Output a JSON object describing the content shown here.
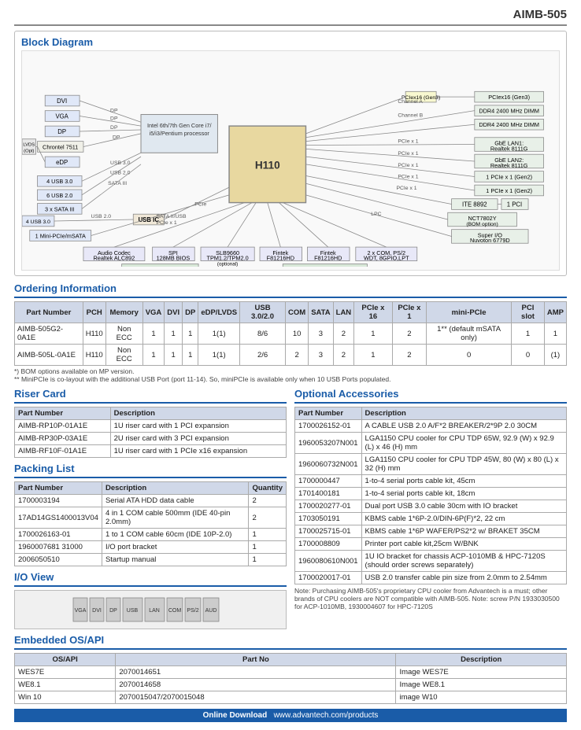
{
  "header": {
    "model": "AIMB-505"
  },
  "block_diagram": {
    "title": "Block Diagram"
  },
  "ordering": {
    "title": "Ordering Information",
    "columns": [
      "Part Number",
      "PCH",
      "Memory",
      "VGA",
      "DVI",
      "DP",
      "eDP/LVDS",
      "USB 3.0/2.0",
      "COM",
      "SATA",
      "LAN",
      "PCIe x 16",
      "PCIe x 1",
      "mini-PCIe",
      "PCI slot",
      "AMP"
    ],
    "rows": [
      [
        "AIMB-505G2-0A1E",
        "H110",
        "Non ECC",
        "1",
        "1",
        "1",
        "1(1)",
        "8/6",
        "10",
        "3",
        "2",
        "1",
        "2",
        "1** (default mSATA only)",
        "1",
        "1"
      ],
      [
        "AIMB-505L-0A1E",
        "H110",
        "Non ECC",
        "1",
        "1",
        "1",
        "1(1)",
        "2/6",
        "2",
        "3",
        "2",
        "1",
        "2",
        "0",
        "0",
        "(1)"
      ]
    ],
    "footnotes": [
      "*) BOM options available on MP version.",
      "** MiniPCIe is co-layout with the additional USB Port (port 11-14). So, miniPCIe is available only when 10 USB Ports populated."
    ]
  },
  "riser_card": {
    "title": "Riser Card",
    "columns": [
      "Part Number",
      "Description"
    ],
    "rows": [
      [
        "AIMB-RP10P-01A1E",
        "1U riser card with 1 PCI expansion"
      ],
      [
        "AIMB-RP30P-03A1E",
        "2U riser card with 3 PCI expansion"
      ],
      [
        "AIMB-RF10F-01A1E",
        "1U riser card with 1 PCIe x16 expansion"
      ]
    ]
  },
  "packing_list": {
    "title": "Packing List",
    "columns": [
      "Part Number",
      "Description",
      "Quantity"
    ],
    "rows": [
      [
        "1700003194",
        "Serial ATA HDD data cable",
        "2"
      ],
      [
        "17AD14GS1400013V04",
        "4 in 1 COM cable 500mm (IDE 40-pin 2.0mm)",
        "2"
      ],
      [
        "1700026163-01",
        "1 to 1 COM cable 60cm (IDE 10P-2.0)",
        "1"
      ],
      [
        "1960007681 31000",
        "I/O port bracket",
        "1"
      ],
      [
        "2006050510",
        "Startup manual",
        "1"
      ]
    ]
  },
  "optional_accessories": {
    "title": "Optional Accessories",
    "columns": [
      "Part Number",
      "Description"
    ],
    "rows": [
      [
        "1700026152-01",
        "A CABLE USB 2.0 A/F*2 BREAKER/2*9P 2.0 30CM"
      ],
      [
        "1960053207N001",
        "LGA1150 CPU cooler for CPU TDP 65W, 92.9 (W) x 92.9 (L) x 46 (H) mm"
      ],
      [
        "1960060732N001",
        "LGA1150 CPU cooler for CPU TDP 45W, 80 (W) x 80 (L) x 32 (H) mm"
      ],
      [
        "1700000447",
        "1-to-4 serial ports cable kit, 45cm"
      ],
      [
        "1701400181",
        "1-to-4 serial ports cable kit, 18cm"
      ],
      [
        "1700020277-01",
        "Dual port USB 3.0 cable 30cm with IO bracket"
      ],
      [
        "1703050191",
        "KBMS cable 1*6P-2.0/DIN-6P(F)*2, 22 cm"
      ],
      [
        "1700025715-01",
        "KBMS cable 1*6P WAFER/PS2*2 w/ BRAKET 35CM"
      ],
      [
        "1700008809",
        "Printer port cable kit,25cm W/BNK"
      ],
      [
        "1960080610N001",
        "1U IO bracket for chassis ACP-1010MB & HPC-7120S (should order screws separately)"
      ],
      [
        "1700020017-01",
        "USB 2.0 transfer cable pin size from 2.0mm to 2.54mm"
      ]
    ]
  },
  "optional_note": "Note: Purchasing AIMB-505's proprietary CPU cooler from Advantech is a must; other brands of CPU coolers are NOT compatible with AIMB-505.\nNote: screw P/N\n1933030500 for ACP-1010MB, 1930004607 for HPC-7120S",
  "io_view": {
    "title": "I/O View"
  },
  "embedded_os": {
    "title": "Embedded OS/API",
    "columns": [
      "OS/API",
      "Part No",
      "Description"
    ],
    "rows": [
      [
        "WES7E",
        "2070014651",
        "Image WES7E"
      ],
      [
        "WE8.1",
        "2070014658",
        "Image WE8.1"
      ],
      [
        "Win 10",
        "2070015047/2070015048",
        "image W10"
      ]
    ]
  },
  "online_download": {
    "label": "Online Download",
    "url": "www.advantech.com/products"
  }
}
